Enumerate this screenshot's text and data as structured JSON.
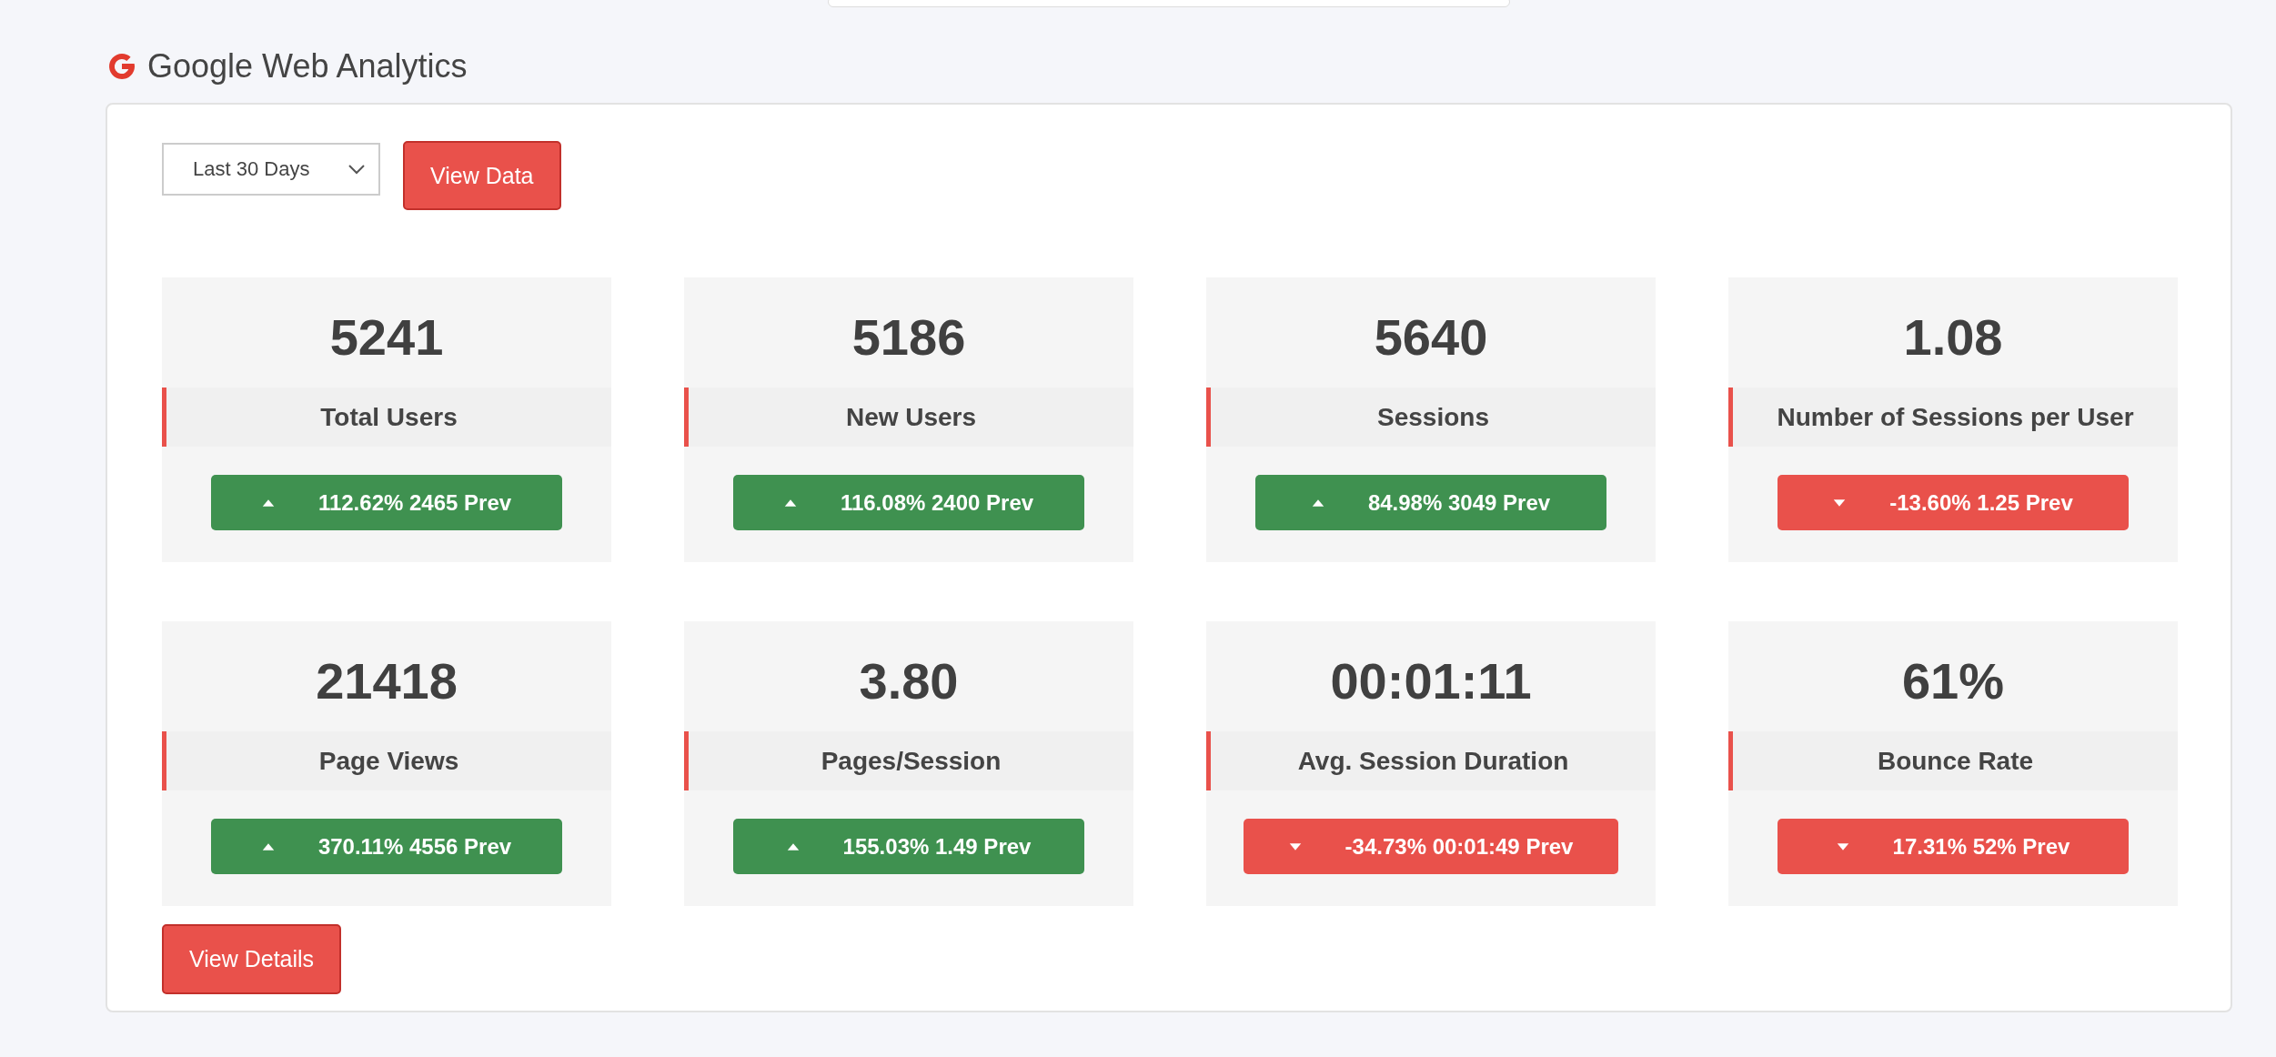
{
  "section": {
    "title": "Google Web Analytics"
  },
  "controls": {
    "period": "Last 30 Days",
    "view_data": "View Data"
  },
  "metrics": [
    {
      "value": "5241",
      "label": "Total Users",
      "kind": "up",
      "change": "112.62% 2465 Prev"
    },
    {
      "value": "5186",
      "label": "New Users",
      "kind": "up",
      "change": "116.08% 2400 Prev"
    },
    {
      "value": "5640",
      "label": "Sessions",
      "kind": "up",
      "change": "84.98% 3049 Prev"
    },
    {
      "value": "1.08",
      "label": "Number of Sessions per User",
      "kind": "down",
      "change": "-13.60% 1.25 Prev"
    },
    {
      "value": "21418",
      "label": "Page Views",
      "kind": "up",
      "change": "370.11% 4556 Prev"
    },
    {
      "value": "3.80",
      "label": "Pages/Session",
      "kind": "up",
      "change": "155.03% 1.49 Prev"
    },
    {
      "value": "00:01:11",
      "label": "Avg. Session Duration",
      "kind": "down",
      "change": "-34.73% 00:01:49 Prev"
    },
    {
      "value": "61%",
      "label": "Bounce Rate",
      "kind": "down",
      "change": "17.31% 52% Prev"
    }
  ],
  "view_details": "View Details"
}
